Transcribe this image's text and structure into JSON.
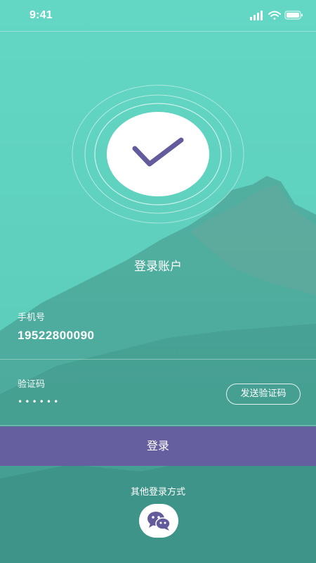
{
  "status_bar": {
    "time": "9:41",
    "signal_icon": "signal-bars-icon",
    "wifi_icon": "wifi-icon",
    "battery_icon": "battery-icon"
  },
  "logo": {
    "icon": "checkmark-icon"
  },
  "title": "登录账户",
  "phone": {
    "label": "手机号",
    "value": "19522800090"
  },
  "code": {
    "label": "验证码",
    "value_masked": "••••••",
    "send_button": "发送验证码"
  },
  "login_button": "登录",
  "other_login": {
    "label": "其他登录方式",
    "icon": "wechat-icon"
  },
  "colors": {
    "background": "#5fd0be",
    "button": "#655e9f",
    "check": "#625c9c",
    "text": "#ffffff"
  }
}
